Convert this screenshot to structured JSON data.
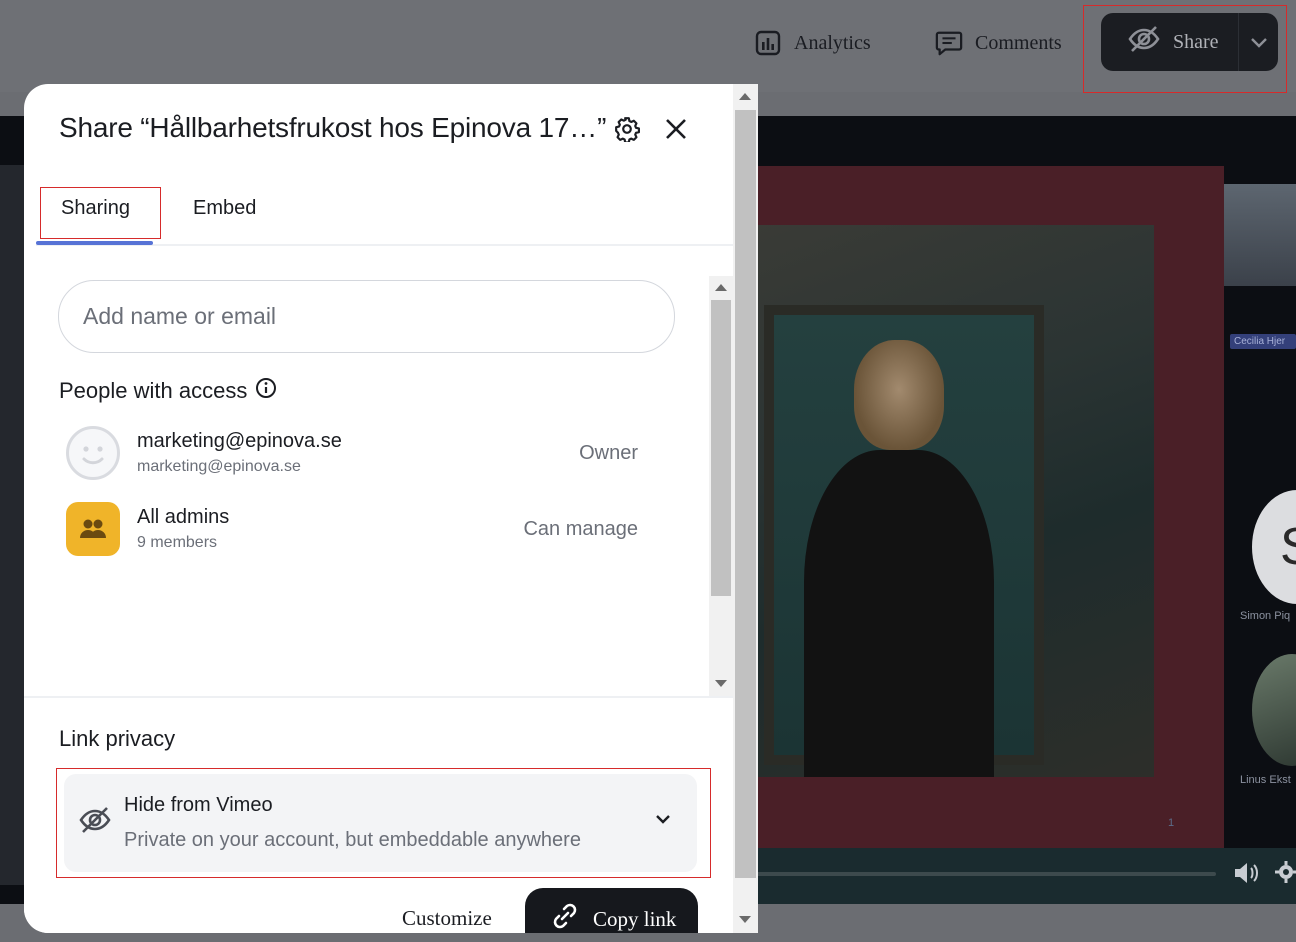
{
  "topbar": {
    "analytics_label": "Analytics",
    "comments_label": "Comments",
    "share_label": "Share"
  },
  "background": {
    "participant_name_1": "Cecilia Hjer",
    "participant_name_2": "Simon Piq",
    "participant_name_3": "Linus Ekst",
    "participant_initial": "S",
    "slide_number": "1"
  },
  "modal": {
    "title": "Share “Hållbarhetsfrukost hos Epinova 17…”",
    "tabs": [
      {
        "label": "Sharing",
        "active": true
      },
      {
        "label": "Embed",
        "active": false
      }
    ],
    "search": {
      "placeholder": "Add name or email",
      "value": ""
    },
    "people_title": "People with access",
    "people": [
      {
        "name": "marketing@epinova.se",
        "sub": "marketing@epinova.se",
        "role": "Owner"
      },
      {
        "name": "All admins",
        "sub": "9 members",
        "role": "Can manage"
      }
    ],
    "privacy": {
      "title": "Link privacy",
      "option_label": "Hide from Vimeo",
      "option_desc": "Private on your account, but embeddable anywhere"
    },
    "customize_label": "Customize",
    "copy_link_label": "Copy link"
  },
  "colors": {
    "accent_tab": "#5773d6",
    "highlight_border": "#d62b2b",
    "group_avatar": "#f0b429",
    "dark_button": "#16181d"
  }
}
